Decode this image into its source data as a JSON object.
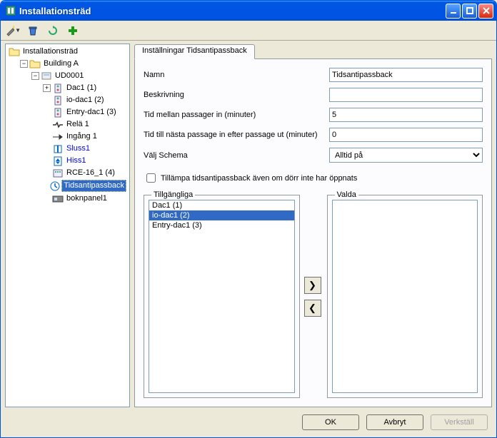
{
  "window": {
    "title": "Installationsträd"
  },
  "toolbar": {
    "icons": {
      "wizard": "wizard-icon",
      "trash": "trash-icon",
      "refresh": "refresh-icon",
      "add": "plus-icon"
    }
  },
  "tree": {
    "root": "Installationsträd",
    "nodes": [
      {
        "label": "Building A",
        "depth": 1,
        "icon": "folder",
        "exp": "-"
      },
      {
        "label": "UD0001",
        "depth": 2,
        "icon": "device",
        "exp": "-"
      },
      {
        "label": "Dac1 (1)",
        "depth": 3,
        "icon": "module",
        "exp": "+"
      },
      {
        "label": "io-dac1 (2)",
        "depth": 3,
        "icon": "module",
        "exp": ""
      },
      {
        "label": "Entry-dac1 (3)",
        "depth": 3,
        "icon": "module",
        "exp": ""
      },
      {
        "label": "Relä 1",
        "depth": 3,
        "icon": "relay",
        "exp": ""
      },
      {
        "label": "Ingång 1",
        "depth": 3,
        "icon": "input",
        "exp": ""
      },
      {
        "label": "Sluss1",
        "depth": 3,
        "icon": "sluss",
        "exp": "",
        "blue": true
      },
      {
        "label": "Hiss1",
        "depth": 3,
        "icon": "hiss",
        "exp": "",
        "blue": true
      },
      {
        "label": "RCE-16_1 (4)",
        "depth": 3,
        "icon": "rce",
        "exp": ""
      },
      {
        "label": "Tidsantipassback",
        "depth": 3,
        "icon": "apb",
        "exp": "",
        "selected": true
      },
      {
        "label": "boknpanel1",
        "depth": 3,
        "icon": "panel",
        "exp": ""
      }
    ]
  },
  "tab": {
    "label": "Inställningar Tidsantipassback"
  },
  "form": {
    "name_label": "Namn",
    "name_value": "Tidsantipassback",
    "desc_label": "Beskrivning",
    "desc_value": "",
    "time_in_label": "Tid mellan passager in (minuter)",
    "time_in_value": "5",
    "time_next_label": "Tid till nästa passage in efter passage ut (minuter)",
    "time_next_value": "0",
    "schema_label": "Välj Schema",
    "schema_value": "Alltid på",
    "checkbox_label": "Tillämpa tidsantipassback även om dörr inte har öppnats"
  },
  "lists": {
    "available_label": "Tillgängliga",
    "selected_label": "Valda",
    "available": [
      {
        "label": "Dac1 (1)",
        "selected": false
      },
      {
        "label": "io-dac1 (2)",
        "selected": true
      },
      {
        "label": "Entry-dac1 (3)",
        "selected": false
      }
    ],
    "valda": []
  },
  "buttons": {
    "ok": "OK",
    "cancel": "Avbryt",
    "apply": "Verkställ"
  },
  "glyphs": {
    "move_right": "❯",
    "move_left": "❮"
  }
}
